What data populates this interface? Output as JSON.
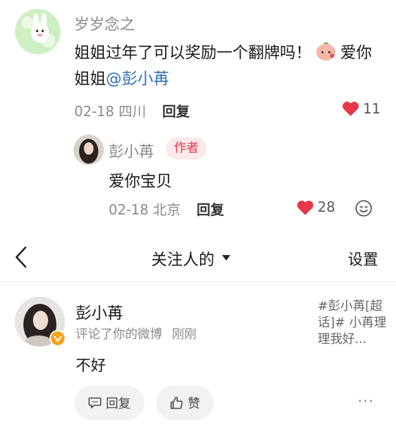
{
  "thread": {
    "comment": {
      "username": "岁岁念之",
      "text_part1": "姐姐过年了可以奖励一个翻牌吗！",
      "text_part2": "爱你姐姐",
      "mention": "@彭小苒",
      "date_location": "02-18 四川",
      "reply_label": "回复",
      "likes": "11"
    },
    "author_reply": {
      "username": "彭小苒",
      "badge": "作者",
      "text": "爱你宝贝",
      "date_location": "02-18 北京",
      "reply_label": "回复",
      "likes": "28"
    }
  },
  "header": {
    "tab_title": "关注人的",
    "settings_label": "设置"
  },
  "notification": {
    "username": "彭小苒",
    "action": "评论了你的微博",
    "time": "刚刚",
    "body": "不好",
    "quote": "#彭小苒[超话]# 小苒理理我好...",
    "reply_label": "回复",
    "like_label": "赞",
    "more_label": "···"
  },
  "colors": {
    "heart": "#e8374a",
    "mention": "#2f6fb3",
    "badge_text": "#e0364c",
    "badge_bg": "#fde8ea",
    "verified": "#f7a21b"
  },
  "icons": [
    "bunny-avatar",
    "peach-emoji",
    "heart-icon",
    "reaction-smile-icon",
    "back-chevron-icon",
    "dropdown-triangle-icon",
    "verified-badge-icon",
    "comment-icon",
    "thumbs-up-icon",
    "more-dots-icon"
  ]
}
